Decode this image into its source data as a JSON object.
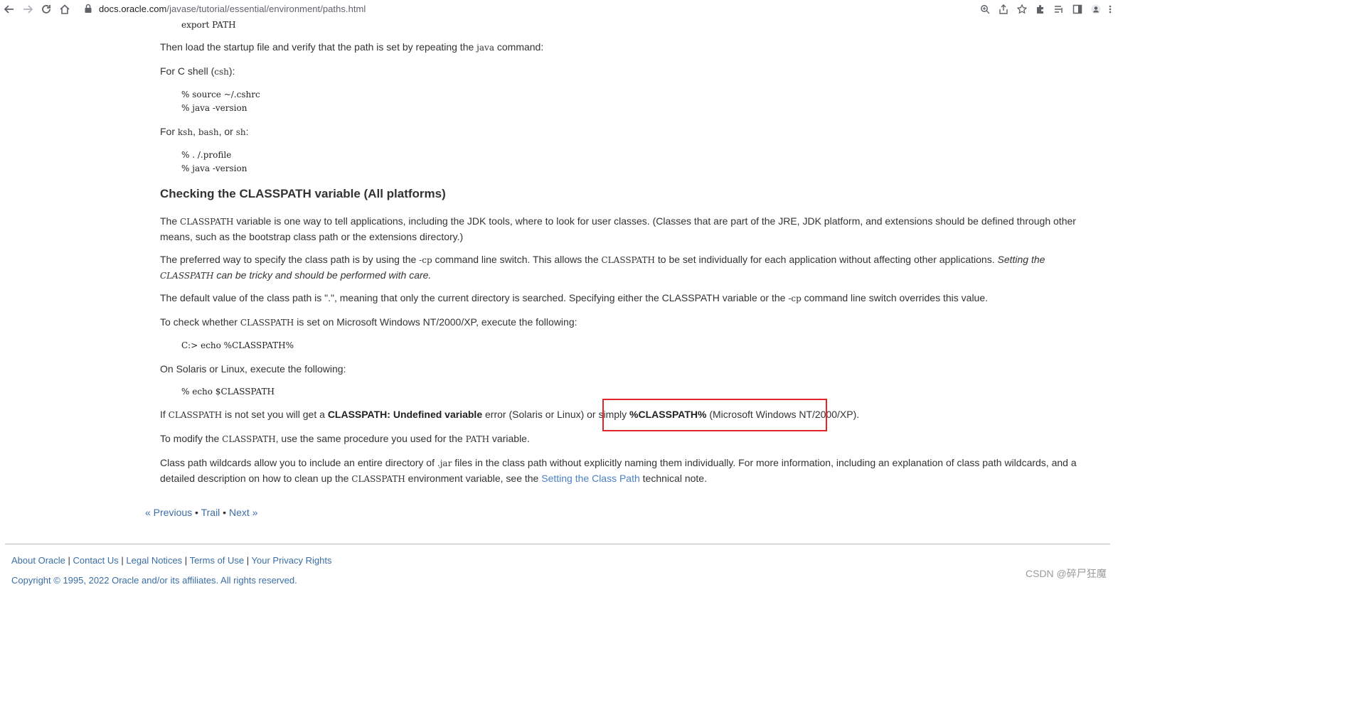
{
  "browser": {
    "url_host": "docs.oracle.com",
    "url_path": "/javase/tutorial/essential/environment/paths.html",
    "icons": [
      "back-icon",
      "forward-icon",
      "reload-icon",
      "home-icon",
      "lock-icon",
      "zoom-icon",
      "share-icon",
      "star-icon",
      "extensions-icon",
      "reading-list-icon",
      "side-panel-icon",
      "profile-icon",
      "menu-icon"
    ]
  },
  "page": {
    "code_export": "export PATH",
    "p_load": {
      "a": "Then load the startup file and verify that the path is set by repeating the ",
      "code": "java",
      "b": " command:"
    },
    "p_csh": {
      "a": "For C shell (",
      "code": "csh",
      "b": "):"
    },
    "code_csh": "% source ~/.cshrc\n% java -version",
    "p_ksh": {
      "a": "For ",
      "c1": "ksh",
      "s1": ", ",
      "c2": "bash",
      "s2": ", or ",
      "c3": "sh",
      "b": ":"
    },
    "code_ksh": "% . /.profile\n% java -version",
    "heading": "Checking the CLASSPATH variable (All platforms)",
    "p_classpath": {
      "a": "The ",
      "code": "CLASSPATH",
      "b": " variable is one way to tell applications, including the JDK tools, where to look for user classes. (Classes that are part of the JRE, JDK platform, and extensions should be defined through other means, such as the bootstrap class path or the extensions directory.)"
    },
    "p_preferred": {
      "a": "The preferred way to specify the class path is by using the ",
      "code1": "-cp",
      "b": " command line switch. This allows the ",
      "code2": "CLASSPATH",
      "c": " to be set individually for each application without affecting other applications. ",
      "em1": "Setting the ",
      "code3": "CLASSPATH",
      "em2": " can be tricky and should be performed with care."
    },
    "p_default": {
      "a": "The default value of the class path is \".\", meaning that only the current directory is searched. Specifying either the CLASSPATH variable or the ",
      "code": "-cp",
      "b": " command line switch overrides this value."
    },
    "p_check": {
      "a": "To check whether ",
      "code": "CLASSPATH",
      "b": " is set on Microsoft Windows NT/2000/XP, execute the following:"
    },
    "code_win": "C:> echo %CLASSPATH%",
    "p_solaris": "On Solaris or Linux, execute the following:",
    "code_sol": "% echo $CLASSPATH",
    "p_ifnot": {
      "a": "If ",
      "code": "CLASSPATH",
      "b": " is not set you will get a ",
      "bold1": "CLASSPATH: Undefined variable",
      "c": " error (Solaris or Linux) or simply ",
      "bold2": "%CLASSPATH%",
      "d": " (Microsoft Windows NT/2000/XP)."
    },
    "p_modify": {
      "a": "To modify the ",
      "code1": "CLASSPATH",
      "b": ", use the same procedure you used for the ",
      "code2": "PATH",
      "c": " variable."
    },
    "p_wildcards": {
      "a": "Class path wildcards allow you to include an entire directory of ",
      "code1": ".jar",
      "b": " files in the class path without explicitly naming them individually. For more information, including an explanation of class path wildcards, and a detailed description on how to clean up the ",
      "code2": "CLASSPATH",
      "c": " environment variable, see the ",
      "link": "Setting the Class Path",
      "d": " technical note."
    }
  },
  "pager": {
    "previous": "« Previous",
    "sep1": " • ",
    "trail": "Trail",
    "sep2": " • ",
    "next": "Next »"
  },
  "footer": {
    "links": [
      "About Oracle",
      "Contact Us",
      "Legal Notices",
      "Terms of Use",
      "Your Privacy Rights"
    ],
    "sep": " | ",
    "copyright": "Copyright © 1995, 2022 Oracle and/or its affiliates. All rights reserved."
  },
  "watermark": "CSDN @碎尸狂魔",
  "highlight_color": "#e0252b"
}
